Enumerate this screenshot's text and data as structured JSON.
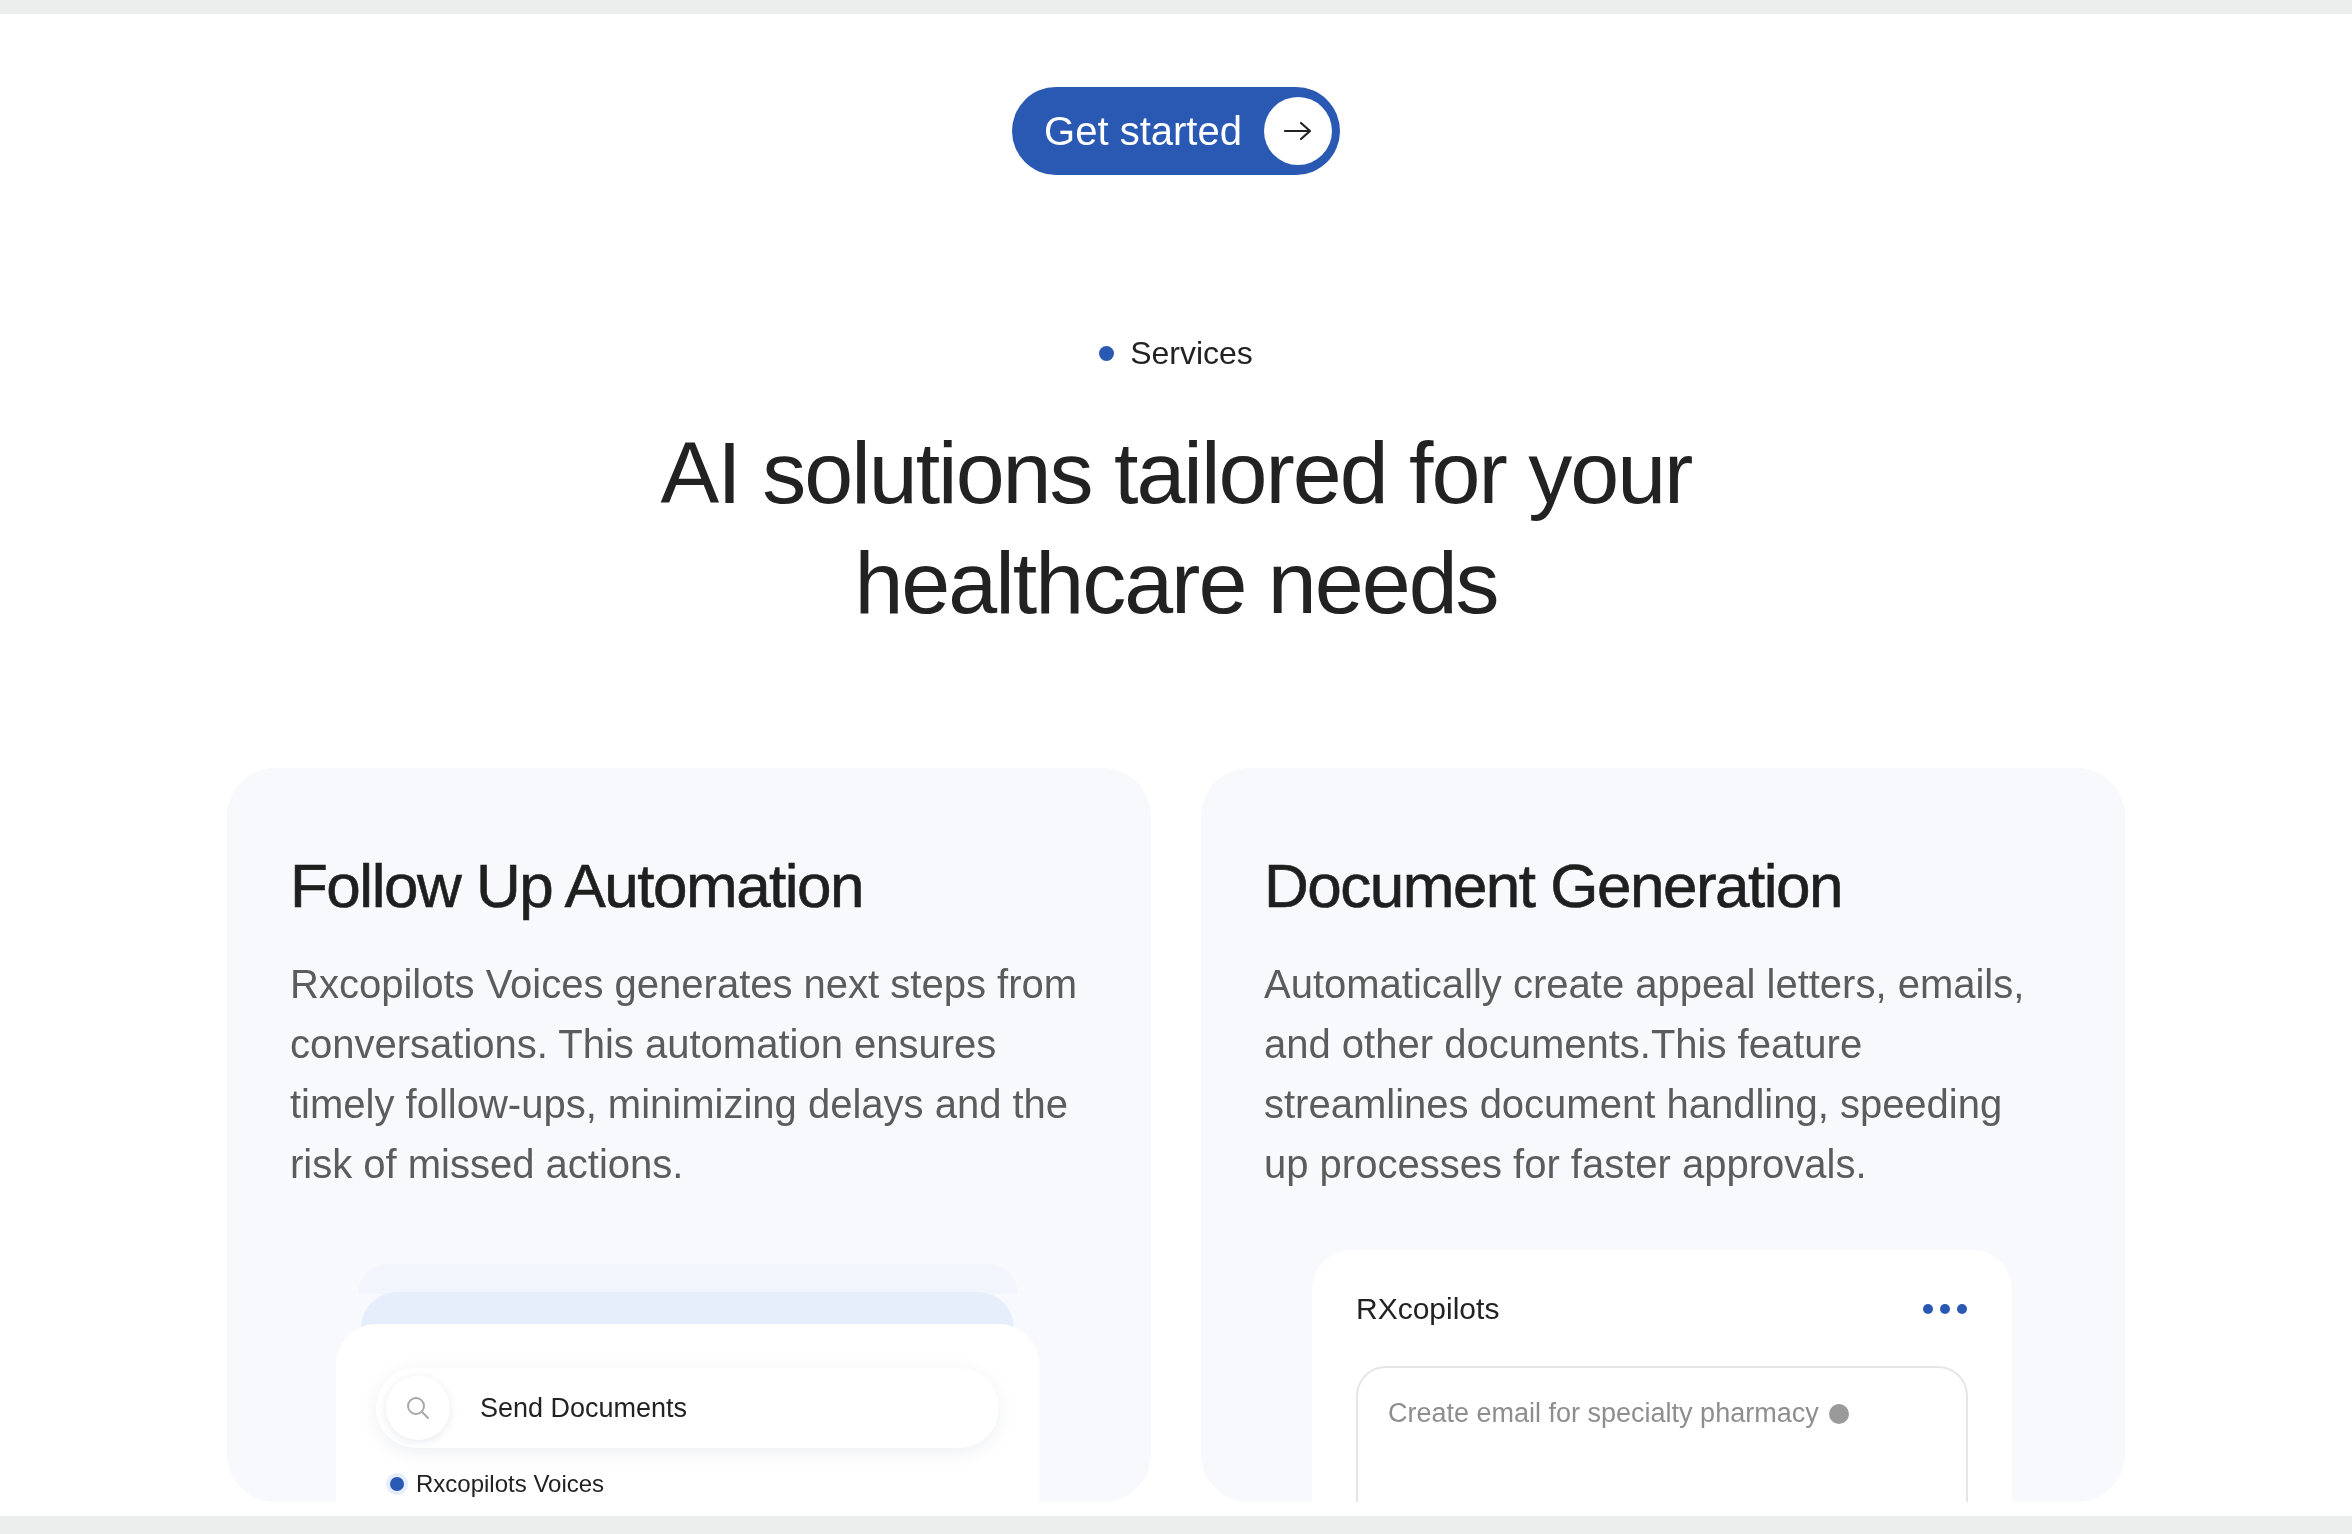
{
  "cta_button": {
    "label": "Get started"
  },
  "section_label": {
    "text": "Services"
  },
  "heading": {
    "text": "AI solutions tailored for your healthcare needs"
  },
  "cards": [
    {
      "title": "Follow Up Automation",
      "description": "Rxcopilots Voices generates next steps from conversations. This automation ensures timely follow-ups, minimizing delays and the risk of missed actions.",
      "mockup": {
        "kind": "search",
        "query": "Send Documents",
        "items": [
          {
            "label": "Rxcopilots Voices"
          }
        ]
      }
    },
    {
      "title": "Document Generation",
      "description": "Automatically create appeal letters, emails, and other documents.This feature streamlines document handling, speeding up processes for faster approvals.",
      "mockup": {
        "kind": "chat",
        "app_name": "RXcopilots",
        "prompt": "Create email for specialty pharmacy"
      }
    }
  ]
}
